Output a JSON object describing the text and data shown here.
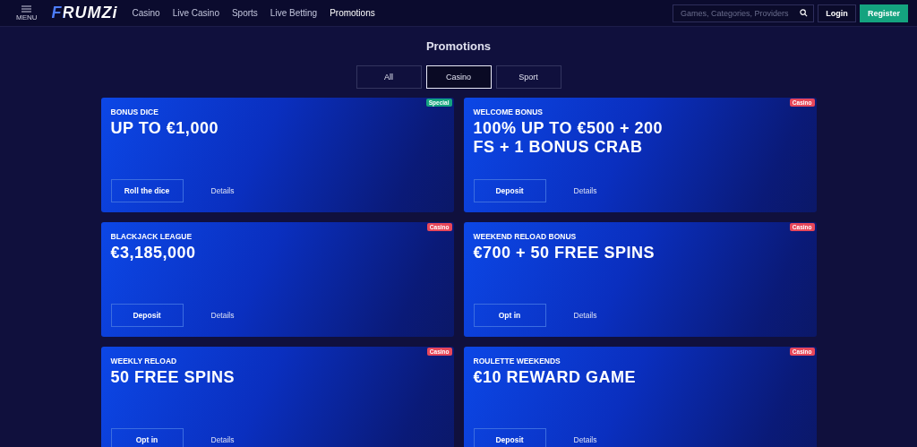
{
  "header": {
    "menu_label": "MENU",
    "logo": "FRUMZi",
    "nav": [
      {
        "label": "Casino",
        "selected": false
      },
      {
        "label": "Live Casino",
        "selected": false
      },
      {
        "label": "Sports",
        "selected": false
      },
      {
        "label": "Live Betting",
        "selected": false
      },
      {
        "label": "Promotions",
        "selected": true
      }
    ],
    "search": {
      "placeholder": "Games, Categories, Providers"
    },
    "login": "Login",
    "register": "Register"
  },
  "page_title": "Promotions",
  "filters": [
    {
      "label": "All",
      "selected": false
    },
    {
      "label": "Casino",
      "selected": true
    },
    {
      "label": "Sport",
      "selected": false
    }
  ],
  "promotions": [
    {
      "name": "BONUS DICE",
      "headline": "UP TO €1,000",
      "tag": "Special",
      "color": "#14a37f",
      "action": "Roll the dice",
      "details": "Details"
    },
    {
      "name": "WELCOME BONUS",
      "headline": "100% UP TO €500 + 200 FS + 1 BONUS CRAB",
      "tag": "Casino",
      "color": "#e8475a",
      "action": "Deposit",
      "details": "Details"
    },
    {
      "name": "BLACKJACK LEAGUE",
      "headline": "€3,185,000",
      "tag": "Casino",
      "color": "#e8475a",
      "action": "Deposit",
      "details": "Details"
    },
    {
      "name": "WEEKEND RELOAD BONUS",
      "headline": "€700 + 50 FREE SPINS",
      "tag": "Casino",
      "color": "#e8475a",
      "action": "Opt in",
      "details": "Details"
    },
    {
      "name": "WEEKLY RELOAD",
      "headline": "50 FREE SPINS",
      "tag": "Casino",
      "color": "#e8475a",
      "action": "Opt in",
      "details": "Details"
    },
    {
      "name": "ROULETTE WEEKENDS",
      "headline": "€10 REWARD GAME",
      "tag": "Casino",
      "color": "#e8475a",
      "action": "Deposit",
      "details": "Details"
    }
  ]
}
